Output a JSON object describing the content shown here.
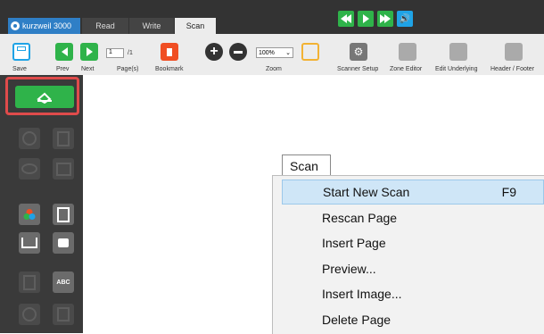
{
  "app": {
    "logo_text": "kurzweil 3000"
  },
  "tabs": [
    {
      "label": "Read"
    },
    {
      "label": "Write"
    },
    {
      "label": "Scan"
    }
  ],
  "toolbar": {
    "save": "Save",
    "prev": "Prev",
    "next": "Next",
    "page_value": "1",
    "page_total": "/1",
    "pages_label": "Page(s)",
    "bookmark": "Bookmark",
    "zoom_value": "100%",
    "zoom_label": "Zoom",
    "scanner_setup": "Scanner Setup",
    "zone_editor": "Zone Editor",
    "edit_underlying": "Edit Underlying",
    "header_footer": "Header / Footer"
  },
  "menu": {
    "title": "Scan",
    "items": [
      {
        "label": "Start New Scan",
        "shortcut": "F9"
      },
      {
        "label": "Rescan Page"
      },
      {
        "label": "Insert Page"
      },
      {
        "label": "Preview..."
      },
      {
        "label": "Insert Image..."
      },
      {
        "label": "Delete Page"
      }
    ]
  },
  "icons": {
    "scan": "scan-icon",
    "save": "save-icon",
    "bookmark": "bookmark-icon",
    "zoom_in": "zoom-in-icon",
    "zoom_out": "zoom-out-icon"
  },
  "colors": {
    "green": "#2fb34a",
    "blue": "#1fa3e6",
    "orange": "#f04e23",
    "highlight": "#cfe6f7"
  }
}
